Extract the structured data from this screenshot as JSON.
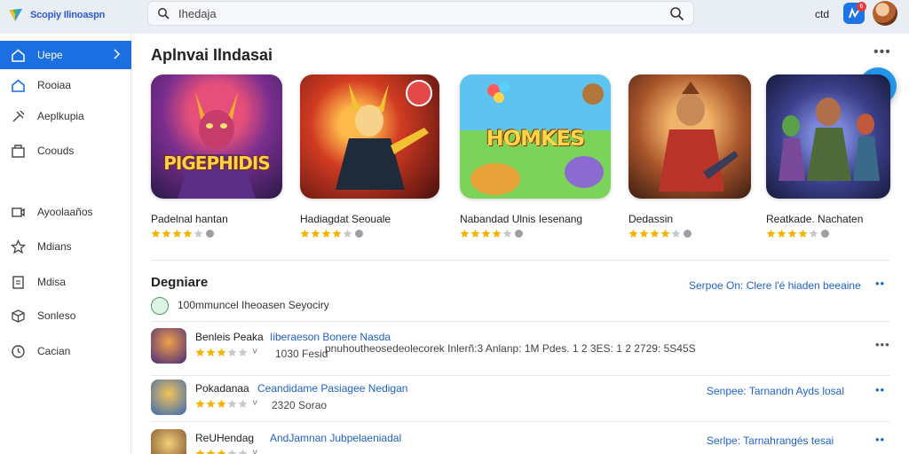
{
  "colors": {
    "accent": "#1b6fe0",
    "link": "#2062c9",
    "star": "#f4b400",
    "fab": "#2396ea"
  },
  "header": {
    "brand_name": "Scopiy Ilinoaspn",
    "search_value": "Ihedaja",
    "right_label": "ctd",
    "notification_count": "6"
  },
  "sidebar": {
    "items": [
      {
        "label": "Uepe",
        "icon": "home-icon"
      },
      {
        "label": "Rooiaa",
        "icon": "home-outline-icon"
      },
      {
        "label": "Aeplkupia",
        "icon": "tools-icon"
      },
      {
        "label": "Coouds",
        "icon": "store-icon"
      },
      {
        "label": "Ayoolaaños",
        "icon": "video-icon"
      },
      {
        "label": "Mdians",
        "icon": "star-icon"
      },
      {
        "label": "Mdisa",
        "icon": "document-icon"
      },
      {
        "label": "Sonleso",
        "icon": "cube-icon"
      },
      {
        "label": "Cacian",
        "icon": "clock-icon"
      }
    ]
  },
  "featured": {
    "title": "Aplnvai Ilndasai",
    "apps": [
      {
        "name": "Padelnal hantan",
        "thumb_text": "PIGEPHIDIS",
        "rating": 4
      },
      {
        "name": "Hadiagdat Seouale",
        "thumb_text": "",
        "rating": 4
      },
      {
        "name": "Nabandad Ulnis Iesenang",
        "thumb_text": "HOMKES",
        "rating": 4
      },
      {
        "name": "Dedassin",
        "thumb_text": "",
        "rating": 4
      },
      {
        "name": "Reatkade. Nachaten",
        "thumb_text": "",
        "rating": 4
      }
    ]
  },
  "list_section": {
    "title": "Degniare",
    "link": "Serpoe On: Clere l'é hiaden beeaine",
    "meta": "100mmuncel Iheoasen Seyociry",
    "rows": [
      {
        "name": "Benleis Peaka",
        "desc": "Iiberaeson Bonere Nasda",
        "rating": 3,
        "stat": "1030 Fesid",
        "detail": "pnuhoutheosedeolecorek Inlerñ:3 Anlanp: 1M Pdes. 1 2 3ES: 1 2 2729: 5S45S",
        "link": ""
      },
      {
        "name": "Pokadanaa",
        "desc": "Ceandidame Pasiagee Nedigan",
        "rating": 3,
        "stat": "2320 Sorao",
        "detail": "",
        "link": "Senpee: Tarnandn Ayds losal"
      },
      {
        "name": "ReUHendag",
        "desc": "AndJamnan Jubpelaeniadal",
        "rating": 3,
        "stat": "",
        "detail": "",
        "link": "Serlpe: Tarnahrangés tesai"
      }
    ]
  }
}
